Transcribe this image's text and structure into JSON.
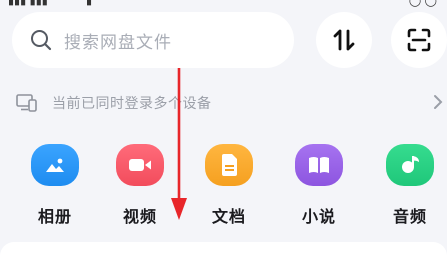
{
  "search": {
    "placeholder": "搜索网盘文件"
  },
  "device_notice": {
    "text": "当前已同时登录多个设备"
  },
  "shortcuts": [
    {
      "label": "相册",
      "color": "#1E8CF0"
    },
    {
      "label": "视频",
      "color": "#F24C5C"
    },
    {
      "label": "文档",
      "color": "#F5A020"
    },
    {
      "label": "小说",
      "color": "#8D55E0"
    },
    {
      "label": "音频",
      "color": "#1FC77A"
    }
  ],
  "colors": {
    "background": "#F4F5F9",
    "annotation_arrow": "#E8262A"
  },
  "icons": [
    "search-icon",
    "sort-icon",
    "scan-icon",
    "devices-icon",
    "chevron-right-icon"
  ]
}
